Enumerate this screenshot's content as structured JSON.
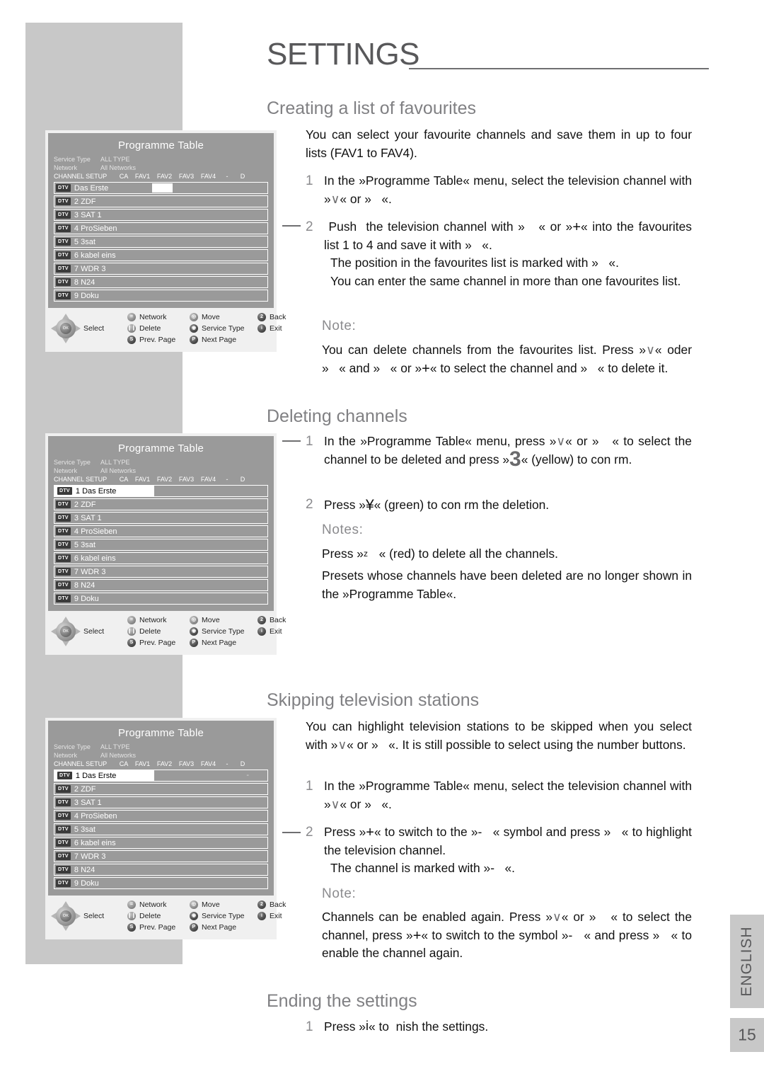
{
  "page": {
    "title": "SETTINGS",
    "language_tab": "ENGLISH",
    "page_number": "15"
  },
  "sections": [
    {
      "heading": "Creating a list of favourites",
      "intro": "You can select your favourite channels and save them in up to four lists (FAV1 to FAV4).",
      "steps": [
        {
          "num": "1",
          "text_a": "In the »Programme Table« menu, select the television channel with »",
          "sym_a": "V",
          "text_b": "« or »",
          "sym_b": "",
          "text_c": "«."
        },
        {
          "num": "2",
          "text_a": " Push  the television channel with »",
          "sym_a": "",
          "text_b": "« or »",
          "sym_b": "+",
          "text_c": "« into the favourites list 1 to 4 and save it with »   «.",
          "sub1": "The position in the favourites list is marked with »   «.",
          "sub2": "You can enter the same channel in more than one favourites list."
        }
      ],
      "note_label": "Note:",
      "note_text": "You can delete channels from the favourites list. Press »V« oder »   « and »   « or »+« to select the channel and »   « to delete it."
    },
    {
      "heading": "Deleting channels",
      "steps": [
        {
          "num": "1",
          "text": "In the »Programme Table« menu, press »V« or »   « to select the channel to be deleted and press »3« (yellow) to con rm."
        },
        {
          "num": "2",
          "text": "Press »¥« (green) to con rm the deletion."
        }
      ],
      "note_label": "Notes:",
      "note_text_1": "Press »z   « (red) to delete all the channels.",
      "note_text_2": "Presets whose channels have been deleted are no longer shown in the »Programme Table«."
    },
    {
      "heading": "Skipping television stations",
      "intro": "You can highlight television stations to be skipped when you select with »V« or »   «. It is still possible to select using the number buttons.",
      "steps": [
        {
          "num": "1",
          "text": "In the »Programme Table« menu, select the television channel with »V« or »   «."
        },
        {
          "num": "2",
          "text": "Press »+« to switch to the »-   « symbol and press »   « to highlight the television channel.",
          "sub1": "The channel is marked with »-   «."
        }
      ],
      "note_label": "Note:",
      "note_text": "Channels can be enabled again. Press »V« or »   « to select the channel, press »+« to switch to the symbol »-   « and press »   « to enable the channel again."
    },
    {
      "heading": "Ending the settings",
      "steps": [
        {
          "num": "1",
          "text": "Press »i« to  nish the settings."
        }
      ]
    }
  ],
  "osd": {
    "title": "Programme Table",
    "meta": [
      {
        "label": "Service Type",
        "value": "ALL TYPE"
      },
      {
        "label": "Network",
        "value": "All Networks"
      }
    ],
    "columns": [
      "CHANNEL SETUP",
      "CA",
      "FAV1",
      "FAV2",
      "FAV3",
      "FAV4",
      "-",
      "D"
    ],
    "badge": "DTV",
    "channels_screen1": [
      "Das Erste",
      "2 ZDF",
      "3 SAT 1",
      "4 ProSieben",
      "5 3sat",
      "6 kabel eins",
      "7 WDR 3",
      "8 N24",
      "9 Doku"
    ],
    "channels_screen2": [
      "1 Das Erste",
      "2 ZDF",
      "3 SAT 1",
      "4 ProSieben",
      "5 3sat",
      "6 kabel eins",
      "7 WDR 3",
      "8 N24",
      "9 Doku"
    ],
    "channels_screen3": [
      "1 Das Erste",
      "2 ZDF",
      "3 SAT 1",
      "4 ProSieben",
      "5 3sat",
      "6 kabel eins",
      "7 WDR 3",
      "8 N24",
      "9 Doku"
    ],
    "skip_marker": "-",
    "legend": {
      "select": "Select",
      "ok": "OK",
      "items": [
        {
          "icon": "=",
          "label": "Network"
        },
        {
          "icon": "",
          "label": "Move"
        },
        {
          "icon": "2",
          "label": "Back"
        },
        {
          "icon": "||",
          "label": "Delete"
        },
        {
          "icon": "o",
          "label": "Service Type"
        },
        {
          "icon": "i",
          "label": "Exit"
        },
        {
          "icon": "S",
          "label": "Prev. Page"
        },
        {
          "icon": "P",
          "label": "Next Page"
        }
      ]
    }
  },
  "colors": {
    "heading": "#808083",
    "grey_block": "#c8c8c8",
    "osd_bg": "#9a9a9a",
    "card_bg": "#f0f0f0"
  }
}
